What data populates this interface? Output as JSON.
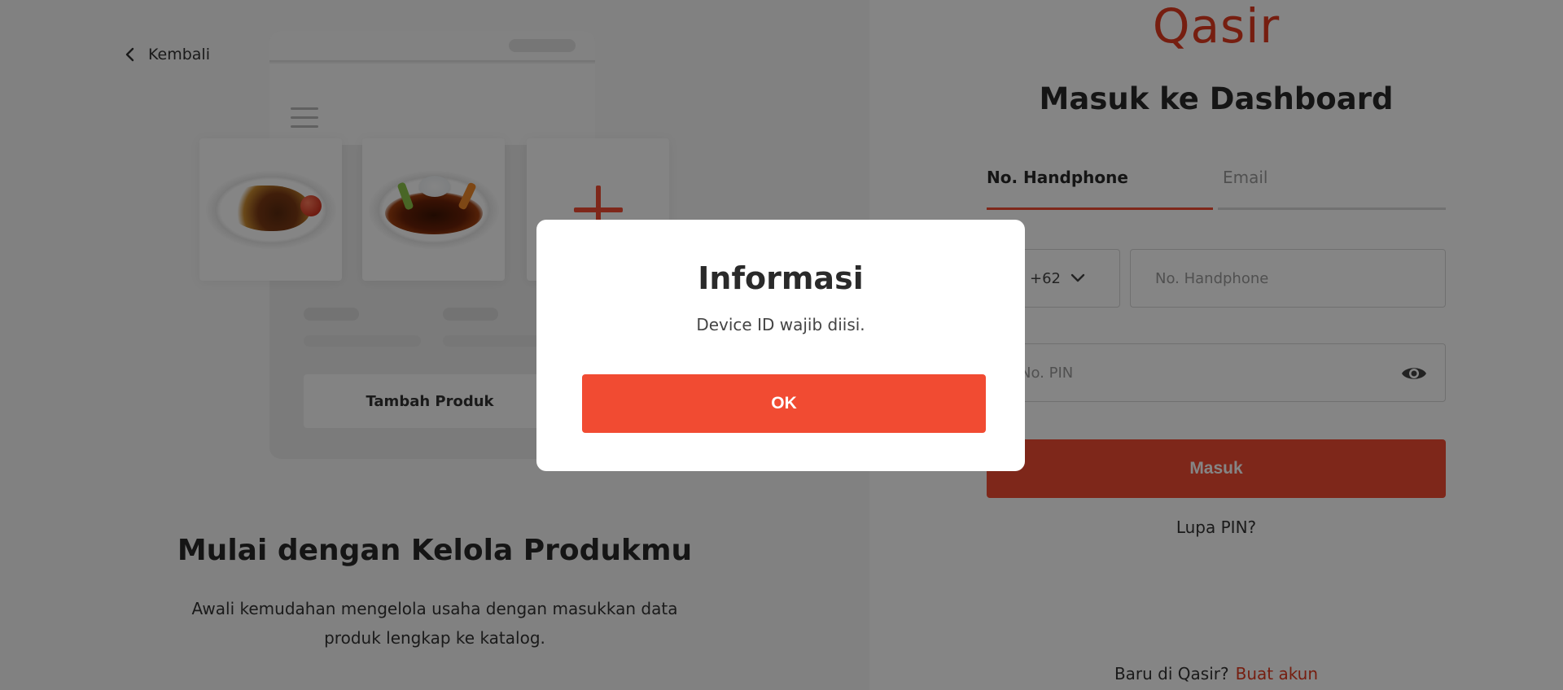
{
  "left": {
    "back_label": "Kembali",
    "illustration": {
      "button_label": "Tambah Produk"
    },
    "title": "Mulai dengan Kelola Produkmu",
    "description": "Awali kemudahan mengelola usaha dengan masukkan data produk lengkap ke katalog."
  },
  "right": {
    "logo": "Qasir",
    "title": "Masuk ke Dashboard",
    "tabs": [
      {
        "label": "No. Handphone",
        "active": true
      },
      {
        "label": "Email",
        "active": false
      }
    ],
    "country_code": "+62",
    "phone_placeholder": "No. Handphone",
    "pin_placeholder": "No. PIN",
    "submit_label": "Masuk",
    "forgot_label": "Lupa PIN?",
    "signup_prompt": "Baru di Qasir?",
    "signup_link": "Buat akun"
  },
  "modal": {
    "title": "Informasi",
    "message": "Device ID wajib diisi.",
    "ok_label": "OK"
  },
  "colors": {
    "accent": "#f14b32",
    "logo": "#e23a1f",
    "overlay": "rgba(0,0,0,0.48)"
  },
  "icons": [
    "chevron-left-icon",
    "hamburger-menu-icon",
    "plus-icon",
    "indonesia-flag-icon",
    "chevron-down-icon",
    "eye-icon"
  ]
}
